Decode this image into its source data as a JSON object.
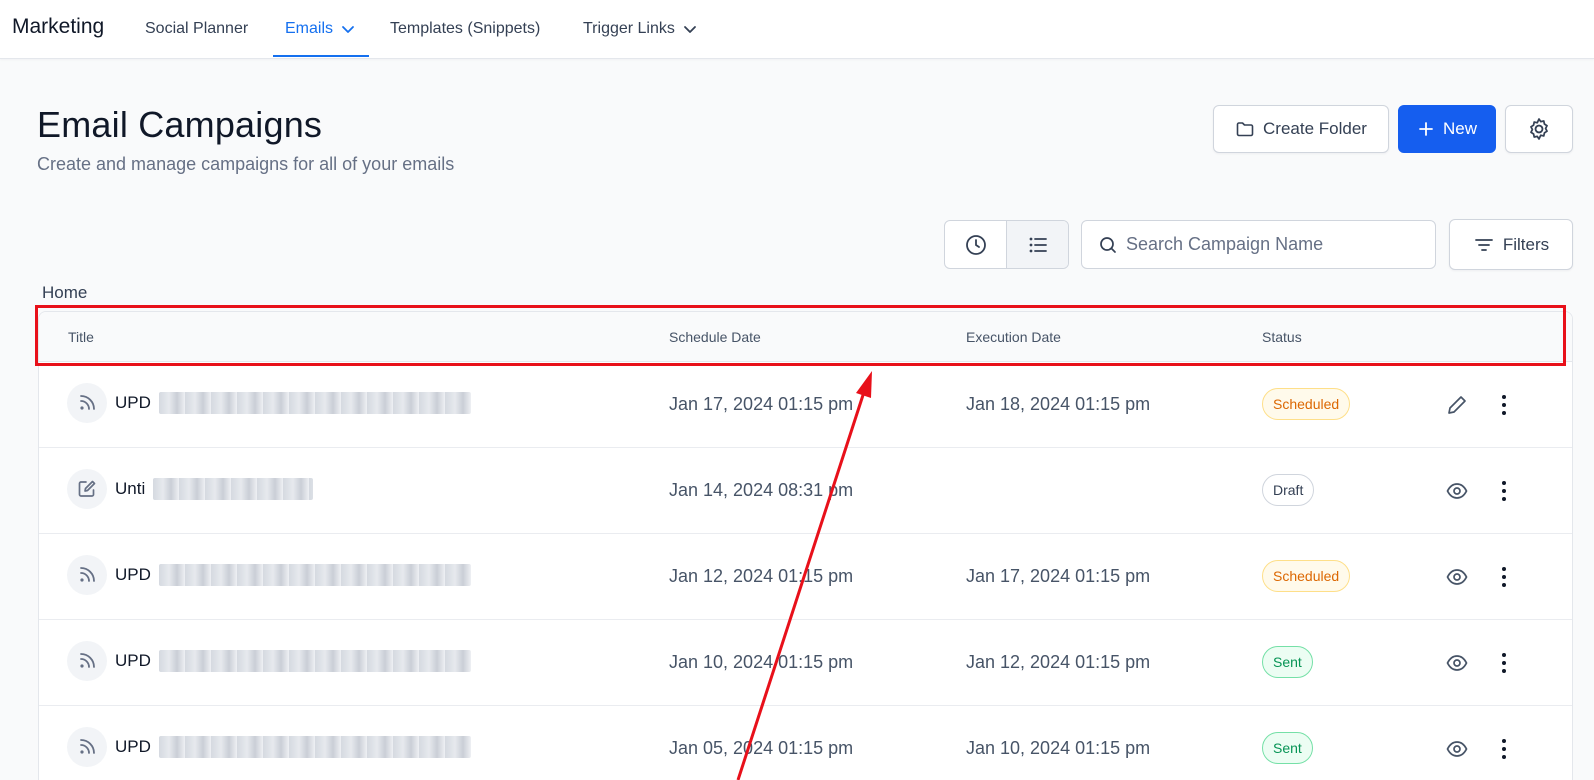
{
  "nav": {
    "brand": "Marketing",
    "items": [
      {
        "label": "Social Planner"
      },
      {
        "label": "Emails"
      },
      {
        "label": "Templates (Snippets)"
      },
      {
        "label": "Trigger Links"
      }
    ],
    "active": "Emails"
  },
  "header": {
    "title": "Email Campaigns",
    "subtitle": "Create and manage campaigns for all of your emails",
    "create_folder_label": "Create Folder",
    "new_label": "New"
  },
  "toolbar": {
    "search_placeholder": "Search Campaign Name",
    "filters_label": "Filters"
  },
  "breadcrumb": "Home",
  "table": {
    "columns": [
      "Title",
      "Schedule Date",
      "Execution Date",
      "Status"
    ],
    "rows": [
      {
        "type": "rss-icon",
        "title_prefix": "UPD",
        "schedule_date": "Jan 17, 2024 01:15 pm",
        "execution_date": "Jan 18, 2024 01:15 pm",
        "status": "Scheduled",
        "action": "edit-icon"
      },
      {
        "type": "edit-icon",
        "title_prefix": "Unti",
        "schedule_date": "Jan 14, 2024 08:31 pm",
        "execution_date": "",
        "status": "Draft",
        "action": "eye-icon"
      },
      {
        "type": "rss-icon",
        "title_prefix": "UPD",
        "schedule_date": "Jan 12, 2024 01:15 pm",
        "execution_date": "Jan 17, 2024 01:15 pm",
        "status": "Scheduled",
        "action": "eye-icon"
      },
      {
        "type": "rss-icon",
        "title_prefix": "UPD",
        "schedule_date": "Jan 10, 2024 01:15 pm",
        "execution_date": "Jan 12, 2024 01:15 pm",
        "status": "Sent",
        "action": "eye-icon"
      },
      {
        "type": "rss-icon",
        "title_prefix": "UPD",
        "schedule_date": "Jan 05, 2024 01:15 pm",
        "execution_date": "Jan 10, 2024 01:15 pm",
        "status": "Sent",
        "action": "eye-icon"
      }
    ]
  },
  "colors": {
    "accent": "#155eef",
    "annotation": "#e8101a",
    "scheduled": "#dc6803",
    "sent": "#079455"
  }
}
